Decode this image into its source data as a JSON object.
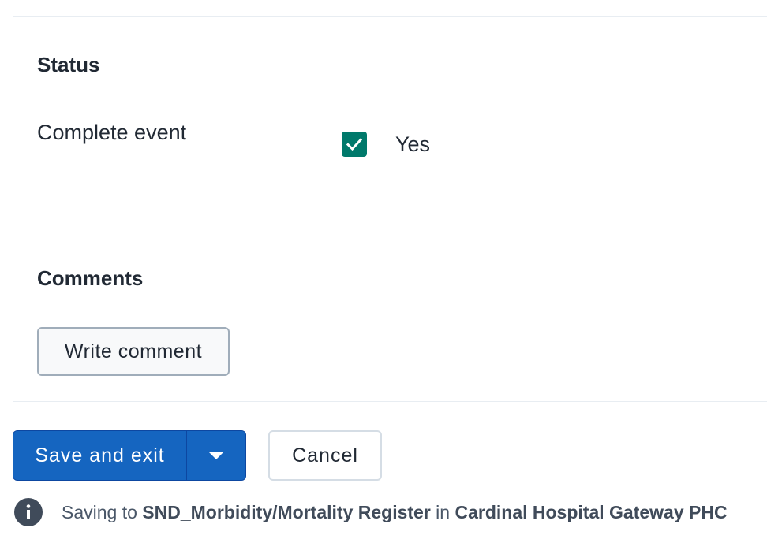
{
  "status_section": {
    "title": "Status",
    "complete_event_label": "Complete event",
    "complete_event_checked": true,
    "complete_event_option": "Yes"
  },
  "comments_section": {
    "title": "Comments",
    "write_comment_label": "Write comment"
  },
  "actions": {
    "save_label": "Save and exit",
    "cancel_label": "Cancel"
  },
  "saving_info": {
    "prefix": "Saving to ",
    "program": "SND_Morbidity/Mortality Register",
    "connector": " in ",
    "org_unit": "Cardinal Hospital Gateway PHC"
  },
  "colors": {
    "primary": "#1565c0",
    "checkbox": "#00796b",
    "text": "#212934"
  },
  "icons": {
    "checkbox": "check-icon",
    "dropdown": "caret-down-icon",
    "info": "info-icon"
  }
}
